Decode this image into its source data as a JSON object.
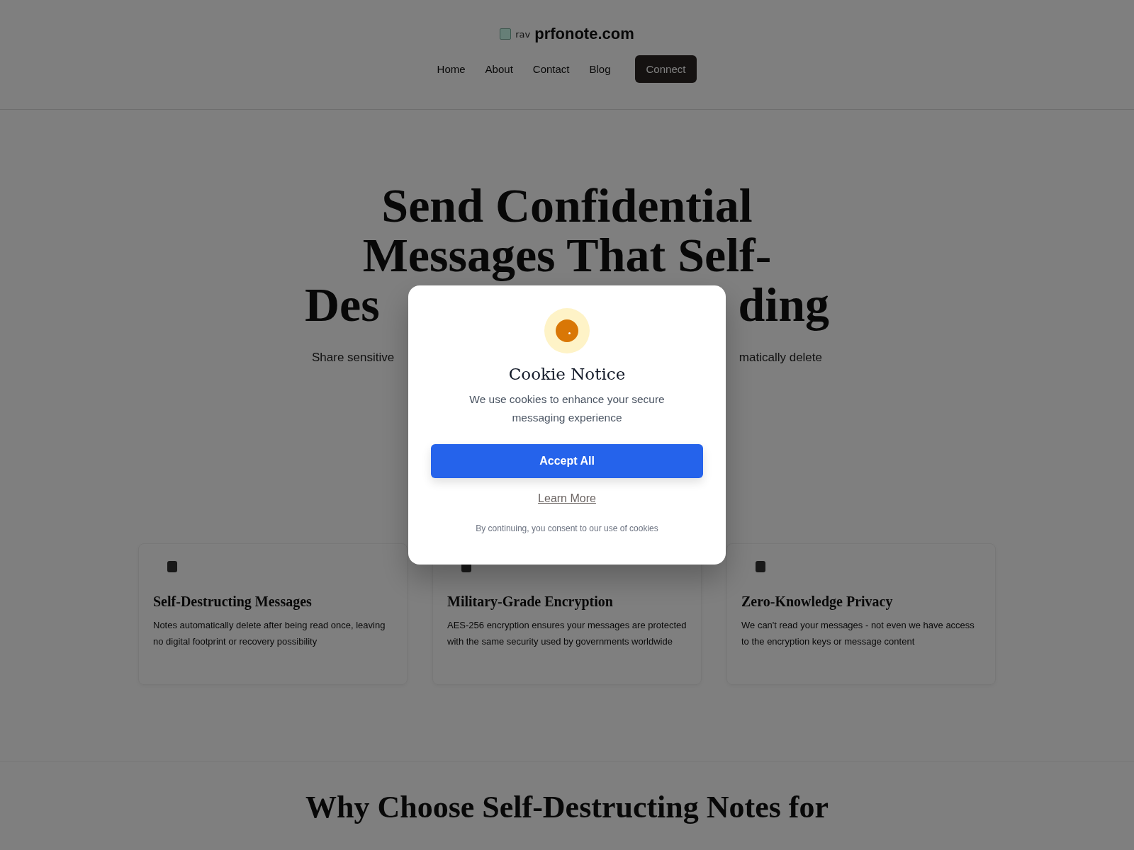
{
  "header": {
    "logo_alt": "rav",
    "site_name": "prfonote.com",
    "nav": [
      "Home",
      "About",
      "Contact",
      "Blog"
    ],
    "nav_button": "Connect"
  },
  "hero": {
    "title_lines": [
      [
        "Send Confidential"
      ],
      [
        "Messages That Self-"
      ],
      [
        "Des",
        "ding"
      ]
    ],
    "subtitle": [
      "Share sensitive",
      "matically delete"
    ]
  },
  "features": [
    {
      "title": "Self-Destructing Messages",
      "text": "Notes automatically delete after being read once, leaving no digital footprint or recovery possibility"
    },
    {
      "title": "Military-Grade Encryption",
      "text": "AES-256 encryption ensures your messages are protected with the same security used by governments worldwide"
    },
    {
      "title": "Zero-Knowledge Privacy",
      "text": "We can't read your messages - not even we have access to the encryption keys or message content"
    }
  ],
  "section_heading": "Why Choose Self-Destructing Notes for",
  "cookie_dialog": {
    "title": "Cookie Notice",
    "message": "We use cookies to enhance your secure messaging experience",
    "accept_button": "Accept All",
    "learn_more": "Learn More",
    "footnote": "By continuing, you consent to our use of cookies"
  }
}
